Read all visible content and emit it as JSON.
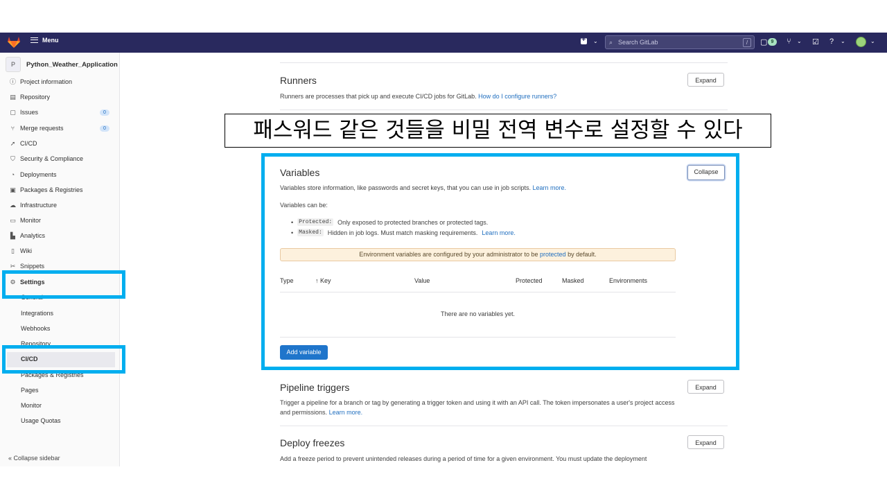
{
  "topbar": {
    "menu_label": "Menu",
    "search_placeholder": "Search GitLab",
    "search_shortcut": "/",
    "issues_count": "9"
  },
  "sidebar": {
    "project_avatar": "P",
    "project_name": "Python_Weather_Application",
    "items": [
      {
        "label": "Project information",
        "icon": "info-icon"
      },
      {
        "label": "Repository",
        "icon": "file-icon"
      },
      {
        "label": "Issues",
        "icon": "issues-icon",
        "count": "0"
      },
      {
        "label": "Merge requests",
        "icon": "merge-request-icon",
        "count": "0"
      },
      {
        "label": "CI/CD",
        "icon": "rocket-icon"
      },
      {
        "label": "Security & Compliance",
        "icon": "shield-icon"
      },
      {
        "label": "Deployments",
        "icon": "deployments-icon"
      },
      {
        "label": "Packages & Registries",
        "icon": "package-icon"
      },
      {
        "label": "Infrastructure",
        "icon": "cloud-icon"
      },
      {
        "label": "Monitor",
        "icon": "monitor-icon"
      },
      {
        "label": "Analytics",
        "icon": "chart-icon"
      },
      {
        "label": "Wiki",
        "icon": "book-icon"
      },
      {
        "label": "Snippets",
        "icon": "scissors-icon"
      },
      {
        "label": "Settings",
        "icon": "gear-icon"
      }
    ],
    "settings_sub": [
      "General",
      "Integrations",
      "Webhooks",
      "Repository",
      "CI/CD",
      "Packages & Registries",
      "Pages",
      "Monitor",
      "Usage Quotas"
    ],
    "collapse_label": "Collapse sidebar"
  },
  "annotation_text": "패스워드 같은 것들을 비밀 전역 변수로 설정할 수 있다",
  "runners": {
    "title": "Runners",
    "description": "Runners are processes that pick up and execute CI/CD jobs for GitLab.",
    "link": "How do I configure runners?",
    "button": "Expand"
  },
  "variables": {
    "title": "Variables",
    "description": "Variables store information, like passwords and secret keys, that you can use in job scripts.",
    "learn_more": "Learn more.",
    "can_be": "Variables can be:",
    "protected_code": "Protected:",
    "protected_text": "Only exposed to protected branches or protected tags.",
    "masked_code": "Masked:",
    "masked_text": "Hidden in job logs. Must match masking requirements.",
    "masked_link": "Learn more.",
    "alert_pre": "Environment variables are configured by your administrator to be",
    "alert_link": "protected",
    "alert_post": "by default.",
    "columns": [
      "Type",
      "↑ Key",
      "Value",
      "Protected",
      "Masked",
      "Environments"
    ],
    "empty_text": "There are no variables yet.",
    "add_button": "Add variable",
    "collapse_button": "Collapse"
  },
  "pipeline_triggers": {
    "title": "Pipeline triggers",
    "description": "Trigger a pipeline for a branch or tag by generating a trigger token and using it with an API call. The token impersonates a user's project access and permissions.",
    "link": "Learn more.",
    "button": "Expand"
  },
  "deploy_freezes": {
    "title": "Deploy freezes",
    "description": "Add a freeze period to prevent unintended releases during a period of time for a given environment. You must update the deployment",
    "button": "Expand"
  },
  "colors": {
    "highlight": "#00aeef",
    "topbar": "#29295e",
    "primary": "#1f75cb"
  }
}
